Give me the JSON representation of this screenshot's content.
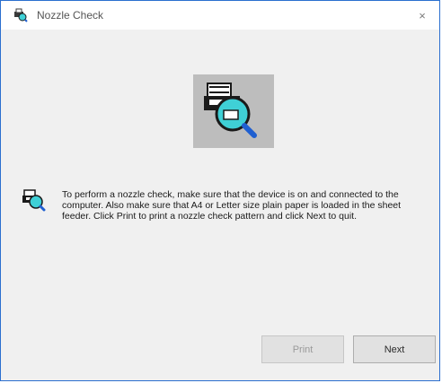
{
  "window": {
    "title": "Nozzle Check",
    "close_glyph": "×"
  },
  "icons": {
    "title": "printer-check-icon",
    "hero": "nozzle-check-magnifier-icon",
    "instruction": "printer-check-icon"
  },
  "content": {
    "instruction_text": "To perform a nozzle check, make sure that the device is on and connected to the computer. Also make sure that A4 or Letter size plain paper is loaded in the sheet feeder. Click Print to print a nozzle check pattern and click Next to quit."
  },
  "buttons": {
    "print_label": "Print",
    "next_label": "Next"
  },
  "colors": {
    "window_border": "#2b6fcf",
    "magnifier_lens": "#3fd0d6",
    "magnifier_handle": "#1f5fd0"
  }
}
